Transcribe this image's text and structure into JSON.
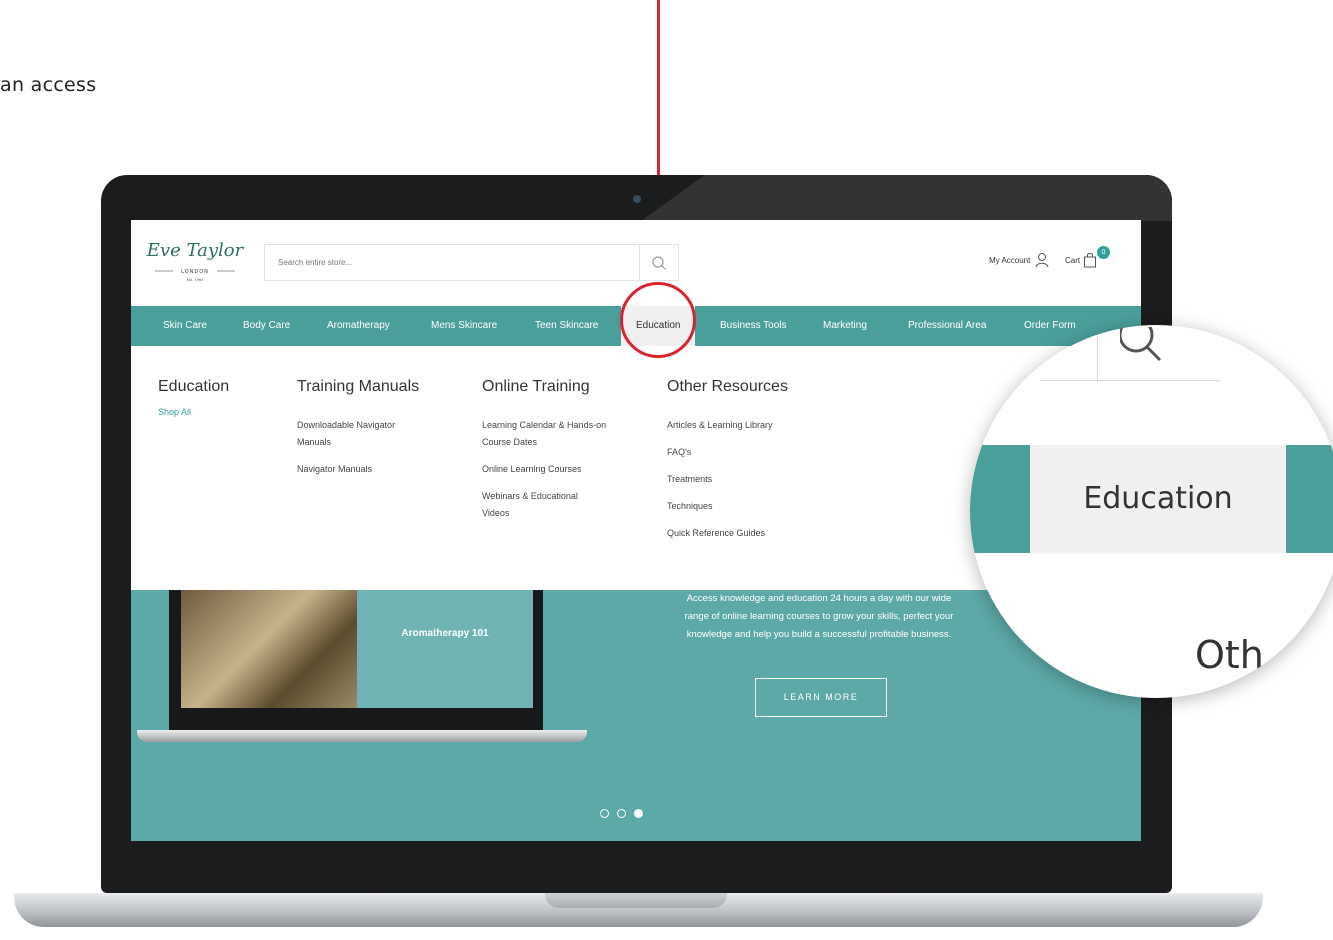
{
  "caption": {
    "text": "an access"
  },
  "header": {
    "logo": {
      "script": "Eve Taylor",
      "city": "LONDON",
      "est": "Est. 1963"
    },
    "search_placeholder": "Search entire store...",
    "account_label": "My Account",
    "cart_label": "Cart",
    "cart_count": "0"
  },
  "nav": {
    "items": [
      {
        "label": "Skin Care"
      },
      {
        "label": "Body Care"
      },
      {
        "label": "Aromatherapy"
      },
      {
        "label": "Mens Skincare"
      },
      {
        "label": "Teen Skincare"
      },
      {
        "label": "Education"
      },
      {
        "label": "Business Tools"
      },
      {
        "label": "Marketing"
      },
      {
        "label": "Professional Area"
      },
      {
        "label": "Order Form"
      }
    ],
    "active": "Education"
  },
  "mega": {
    "education": {
      "title": "Education",
      "shop_all": "Shop All"
    },
    "training_manuals": {
      "title": "Training Manuals",
      "links": [
        "Downloadable Navigator Manuals",
        "Navigator Manuals"
      ]
    },
    "online_training": {
      "title": "Online Training",
      "links": [
        "Learning Calendar & Hands-on Course Dates",
        "Online Learning Courses",
        "Webinars & Educational Videos"
      ]
    },
    "other_resources": {
      "title": "Other Resources",
      "links": [
        "Articles & Learning Library",
        "FAQ's",
        "Treatments",
        "Techniques",
        "Quick Reference Guides"
      ]
    }
  },
  "hero": {
    "mini_title": "Aromatherapy 101",
    "text": "Access knowledge and education 24 hours a day with our wide range of online learning courses to grow your skills, perfect your knowledge and help you build a successful profitable business.",
    "button": "LEARN MORE",
    "slides": 3,
    "active_slide": 3
  },
  "magnifier": {
    "tab_label": "Education",
    "partial_text": "Oth"
  },
  "colors": {
    "teal_nav": "#4b9f9b",
    "teal_hero": "#5da9a8",
    "accent_red": "#d9232e",
    "link_teal": "#2ea39a"
  }
}
